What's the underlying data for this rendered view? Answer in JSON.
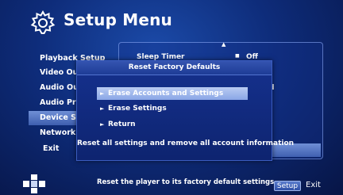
{
  "header": {
    "title": "Setup Menu",
    "icon": "gear-icon"
  },
  "left_menu": {
    "items": [
      {
        "label": "Playback Setup"
      },
      {
        "label": "Video Output"
      },
      {
        "label": "Audio Output"
      },
      {
        "label": "Audio Processing"
      },
      {
        "label": "Device Setup"
      },
      {
        "label": "Network Setup"
      },
      {
        "label": "Exit"
      }
    ],
    "highlighted": "Device Setup"
  },
  "right_panel": {
    "sleep_timer": {
      "label": "Sleep Timer",
      "value": "Off"
    },
    "partial_value": "d"
  },
  "dialog": {
    "title": "Reset Factory Defaults",
    "options": [
      {
        "label": "Erase Accounts and Settings",
        "selected": true
      },
      {
        "label": "Erase Settings",
        "selected": false
      },
      {
        "label": "Return",
        "selected": false
      }
    ],
    "note": "Reset all settings and remove all account information"
  },
  "footer": {
    "hint": "Reset the player to its factory default settings",
    "setup_button": "Setup",
    "exit_label": "Exit"
  },
  "colors": {
    "background": "#0e2c7a",
    "highlight": "#5a7ccc",
    "dialog": "#15318e"
  }
}
